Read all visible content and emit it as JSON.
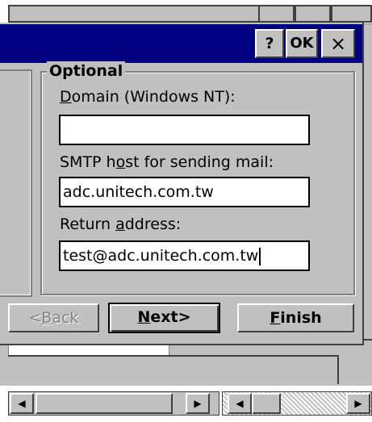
{
  "window": {
    "help_label": "?",
    "ok_label": "OK",
    "close_label": "×"
  },
  "group": {
    "title": "Optional"
  },
  "domain": {
    "label_pre": "",
    "label_ul": "D",
    "label_post": "omain (Windows NT):",
    "value": ""
  },
  "smtp": {
    "label_pre": "SMTP h",
    "label_ul": "o",
    "label_post": "st for sending mail:",
    "value": "adc.unitech.com.tw"
  },
  "return_address": {
    "label_pre": "Return ",
    "label_ul": "a",
    "label_post": "ddress:",
    "value": "test@adc.unitech.com.tw"
  },
  "buttons": {
    "back": {
      "pre": "<",
      "ul": "B",
      "post": "ack"
    },
    "next": {
      "pre": "",
      "ul": "N",
      "post": "ext>"
    },
    "finish": {
      "pre": "",
      "ul": "F",
      "post": "inish"
    }
  },
  "scrollbar": {
    "left_arrow": "◀",
    "right_arrow": "▶"
  }
}
